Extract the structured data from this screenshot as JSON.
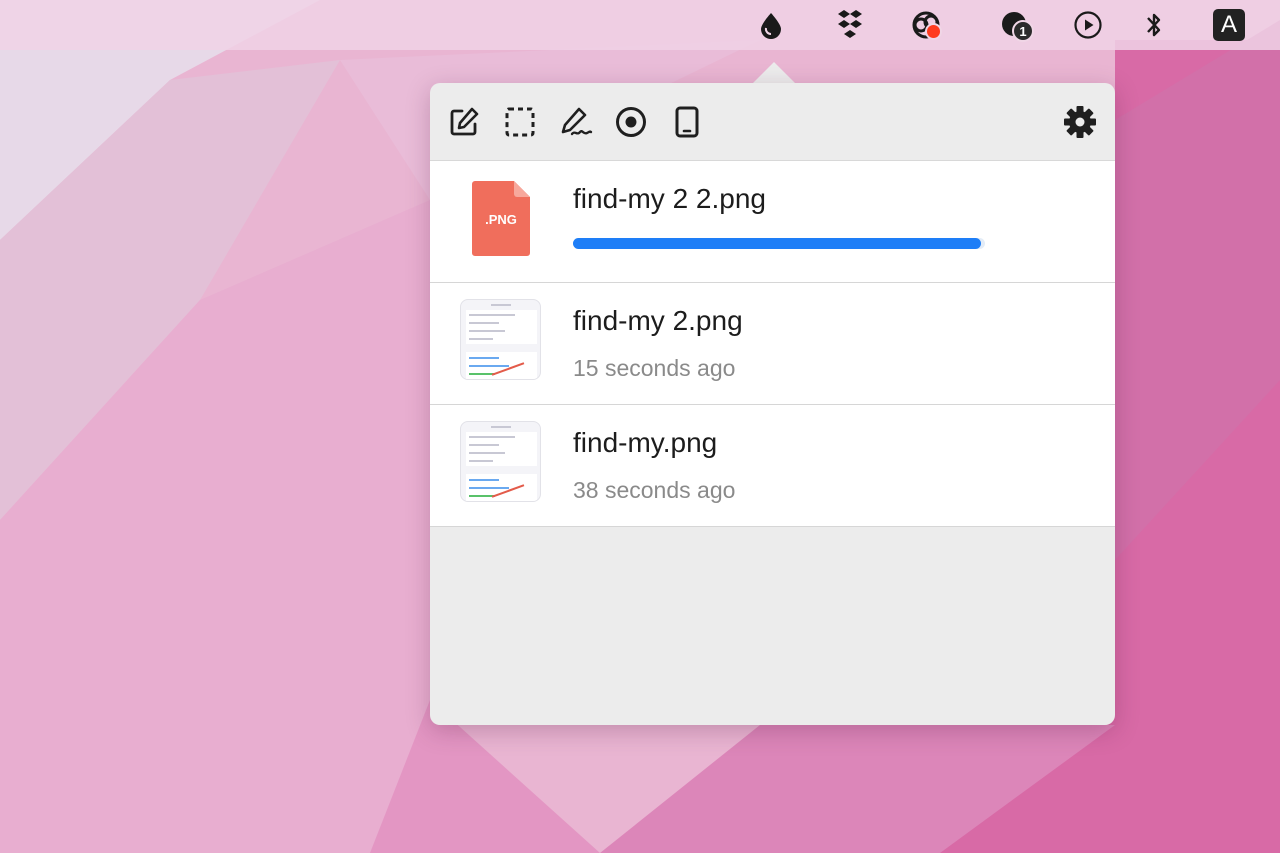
{
  "menubar": {
    "icons": [
      "drop-icon",
      "dropbox-icon",
      "screen-recorder-icon",
      "messages-icon",
      "play-circle-icon",
      "bluetooth-icon",
      "input-source-icon"
    ],
    "messages_badge": "1",
    "input_source_label": "A"
  },
  "popover": {
    "toolbar": {
      "tools": [
        "annotate-icon",
        "area-capture-icon",
        "signature-icon",
        "record-icon",
        "device-frame-icon"
      ],
      "settings": "gear-icon"
    },
    "uploads": [
      {
        "filename": "find-my 2 2.png",
        "file_badge": ".PNG",
        "progress": 0.99
      },
      {
        "filename": "find-my 2.png",
        "time": "15 seconds ago"
      },
      {
        "filename": "find-my.png",
        "time": "38 seconds ago"
      }
    ]
  },
  "colors": {
    "accent": "#1e7ef7",
    "png_file": "#f06e5c",
    "record_dot": "#ff3b1f"
  }
}
